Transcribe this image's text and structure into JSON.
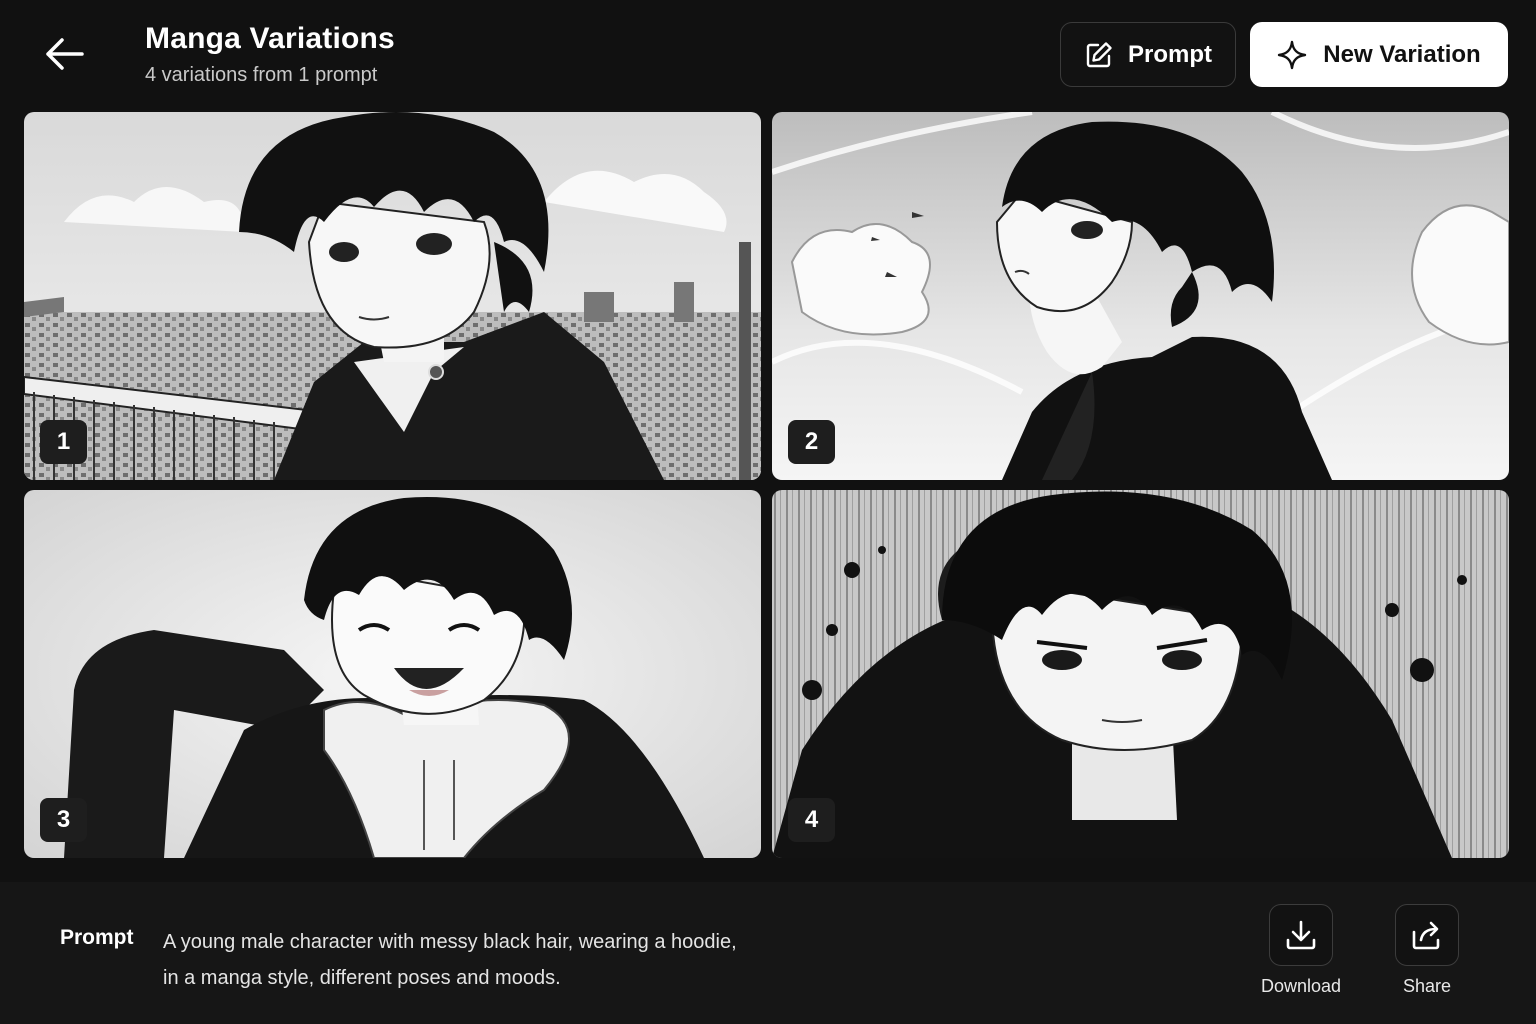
{
  "header": {
    "title": "Manga Variations",
    "subtitle": "4 variations from 1 prompt",
    "prompt_button": "Prompt",
    "new_variation_button": "New Variation"
  },
  "variations": [
    {
      "number": "1",
      "scene": "rooftop city view, high-collar jacket, calm gaze"
    },
    {
      "number": "2",
      "scene": "looking up at sky, hoodie"
    },
    {
      "number": "3",
      "scene": "laughing, hand behind head, jacket over hoodie"
    },
    {
      "number": "4",
      "scene": "intense stare, ink splatter background, dark hoodie"
    }
  ],
  "footer": {
    "prompt_label": "Prompt",
    "prompt_line1": "A young male character with messy black hair, wearing a hoodie,",
    "prompt_line2": "in a manga style, different poses and moods.",
    "download_label": "Download",
    "share_label": "Share"
  },
  "colors": {
    "background": "#111111",
    "panel": "#161616",
    "accent_button": "#ffffff",
    "badge": "#1e1e1e"
  },
  "icons": {
    "back": "arrow-left-icon",
    "prompt": "edit-icon",
    "new_variation": "sparkle-icon",
    "download": "download-icon",
    "share": "share-icon"
  }
}
